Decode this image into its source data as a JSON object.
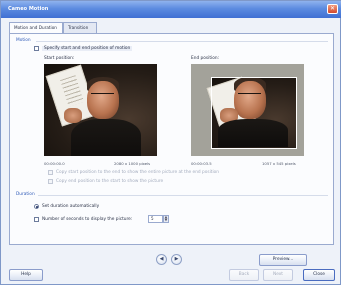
{
  "window": {
    "title": "Cameo Motion",
    "close_glyph": "✕"
  },
  "tabs": [
    {
      "label": "Motion and Duration"
    },
    {
      "label": "Transition"
    }
  ],
  "motion": {
    "section_label": "Motion",
    "specify_label": "Specify start and end position of motion",
    "start_caption": "Start position:",
    "end_caption": "End position:",
    "start_info_left": "00:00:00.0",
    "start_info_right": "2080 x 1000 pixels",
    "end_info_left": "00:00:03.5",
    "end_info_right": "1057 x 545 pixels",
    "option1_label": "Copy start position to the end to show the entire picture at the end position",
    "option2_label": "Copy end position to the start to show the picture"
  },
  "duration": {
    "section_label": "Duration",
    "auto_label": "Set duration automatically",
    "manual_label": "Number of seconds to display the picture:",
    "seconds_value": "5",
    "spin_up": "▲",
    "spin_down": "▼"
  },
  "nav": {
    "prev_glyph": "◀",
    "next_glyph": "▶"
  },
  "buttons": {
    "preview_label": "Preview...",
    "help_label": "Help",
    "back_label": "Back",
    "next_label": "Next",
    "close_label": "Close"
  }
}
